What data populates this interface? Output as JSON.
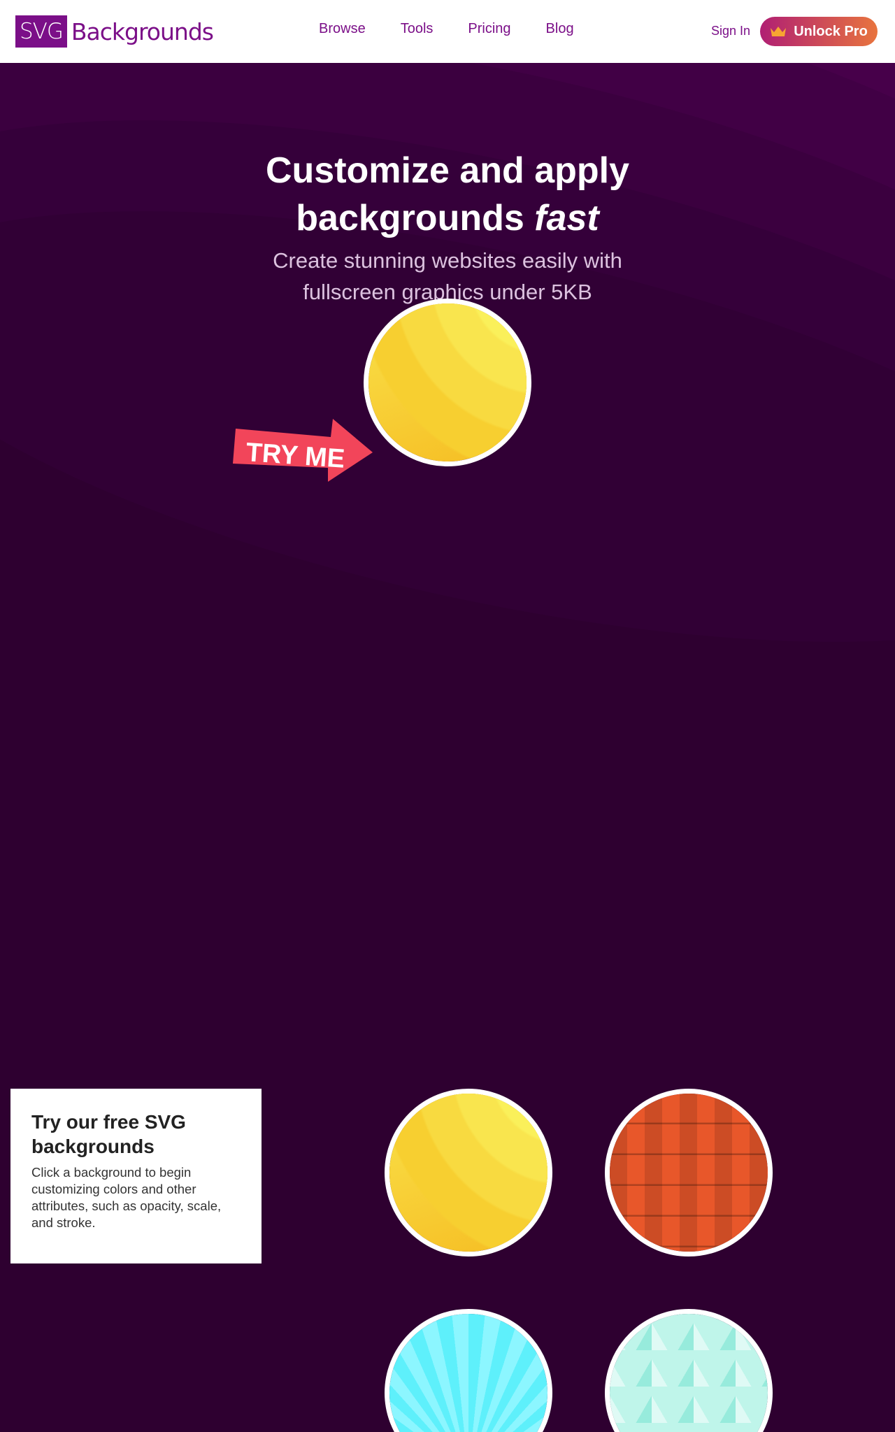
{
  "header": {
    "logo_box": "SVG",
    "logo_word": "Backgrounds",
    "nav": [
      {
        "label": "Browse"
      },
      {
        "label": "Tools"
      },
      {
        "label": "Pricing"
      },
      {
        "label": "Blog"
      }
    ],
    "sign_in": "Sign In",
    "pro_button": "Unlock Pro",
    "crown_icon": "crown-icon",
    "colors": {
      "brand": "#7b0f88",
      "pro_start": "#b01f73",
      "pro_end": "#e8743e"
    }
  },
  "hero": {
    "title_line1": "Customize and apply",
    "title_line2_plain": "backgrounds ",
    "title_line2_em": "fast",
    "subtitle": "Create stunning websites easily with fullscreen graphics under 5KB",
    "try_me": "TRY ME",
    "background_color": "#2e0030"
  },
  "info_card": {
    "title": "Try our free SVG backgrounds",
    "text": "Click a background to begin customizing colors and other attributes, such as opacity, scale, and stroke."
  },
  "backgrounds": [
    {
      "name": "yellow-waves",
      "color": "#f7cf30"
    },
    {
      "name": "orange-blocks",
      "color": "#e8572a"
    },
    {
      "name": "cyan-rays",
      "color": "#5ef0fb"
    },
    {
      "name": "mint-triangles",
      "color": "#bff5ea"
    }
  ]
}
